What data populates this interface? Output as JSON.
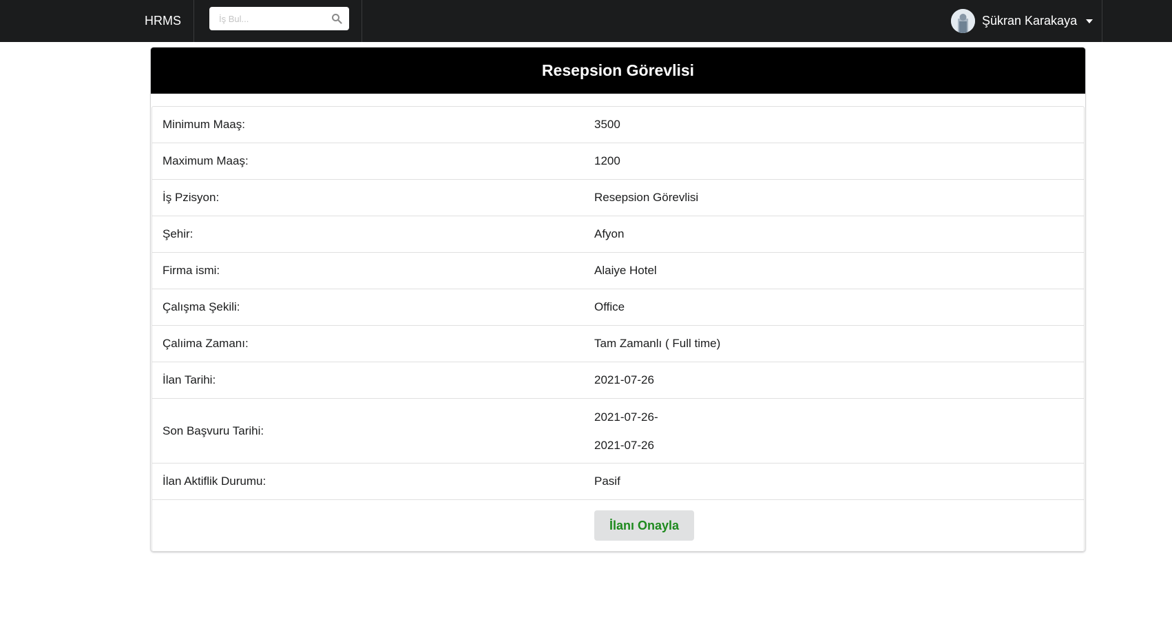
{
  "nav": {
    "brand": "HRMS",
    "search_placeholder": "İş Bul...",
    "user_name": "Şükran Karakaya"
  },
  "icons": {
    "search": "search-icon",
    "avatar": "avatar",
    "caret": "caret-down-icon"
  },
  "colors": {
    "navbar": "#1b1c1d",
    "card_header": "#000000",
    "approve_text": "#1e8a1e",
    "approve_bg": "#e0e1e2"
  },
  "job": {
    "title": "Resepsion Görevlisi",
    "fields": [
      {
        "label": "Minimum Maaş:",
        "value": "3500"
      },
      {
        "label": "Maximum Maaş:",
        "value": "1200"
      },
      {
        "label": "İş Pzisyon:",
        "value": "Resepsion Görevlisi"
      },
      {
        "label": "Şehir:",
        "value": "Afyon"
      },
      {
        "label": "Firma ismi:",
        "value": "Alaiye Hotel"
      },
      {
        "label": "Çalışma Şekili:",
        "value": "Office"
      },
      {
        "label": "Çalıima Zamanı:",
        "value": "Tam Zamanlı ( Full time)"
      },
      {
        "label": "İlan Tarihi:",
        "value": "2021-07-26"
      },
      {
        "label": "Son Başvuru Tarihi:",
        "value": "2021-07-26-",
        "value2": "2021-07-26"
      },
      {
        "label": "İlan Aktiflik Durumu:",
        "value": "Pasif"
      }
    ],
    "approve_label": "İlanı Onayla"
  }
}
